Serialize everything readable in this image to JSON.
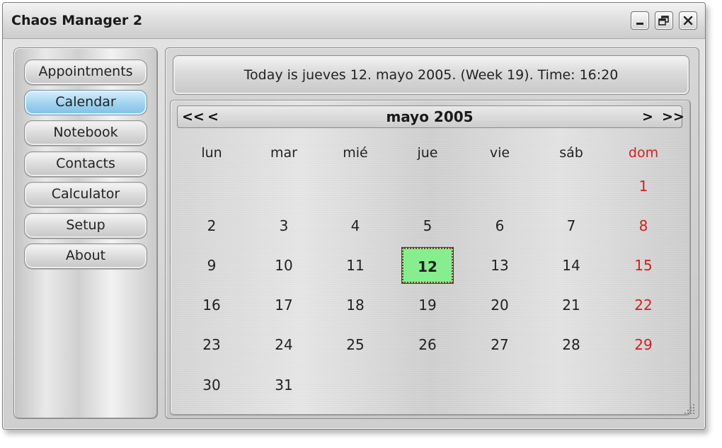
{
  "window": {
    "title": "Chaos Manager 2",
    "controls": {
      "minimize_icon": "minimize-icon",
      "maximize_icon": "maximize-icon",
      "close_icon": "close-icon"
    }
  },
  "sidebar": {
    "items": [
      {
        "label": "Appointments",
        "active": false
      },
      {
        "label": "Calendar",
        "active": true
      },
      {
        "label": "Notebook",
        "active": false
      },
      {
        "label": "Contacts",
        "active": false
      },
      {
        "label": "Calculator",
        "active": false
      },
      {
        "label": "Setup",
        "active": false
      },
      {
        "label": "About",
        "active": false
      }
    ]
  },
  "header": {
    "today_text": "Today is jueves 12. mayo 2005. (Week 19). Time: 16:20"
  },
  "calendar": {
    "prev_year": "<<",
    "prev_month": "<",
    "next_month": ">",
    "next_year": ">>",
    "month_title": "mayo 2005",
    "weekdays": [
      "lun",
      "mar",
      "mié",
      "jue",
      "vie",
      "sáb",
      "dom"
    ],
    "weeks": [
      [
        "",
        "",
        "",
        "",
        "",
        "",
        "1"
      ],
      [
        "2",
        "3",
        "4",
        "5",
        "6",
        "7",
        "8"
      ],
      [
        "9",
        "10",
        "11",
        "12",
        "13",
        "14",
        "15"
      ],
      [
        "16",
        "17",
        "18",
        "19",
        "20",
        "21",
        "22"
      ],
      [
        "23",
        "24",
        "25",
        "26",
        "27",
        "28",
        "29"
      ],
      [
        "30",
        "31",
        "",
        "",
        "",
        "",
        ""
      ]
    ],
    "today": "12",
    "colors": {
      "sunday": "#d21f1f",
      "today_bg": "#86ee8f",
      "active_nav": "#9fd2ef"
    }
  }
}
